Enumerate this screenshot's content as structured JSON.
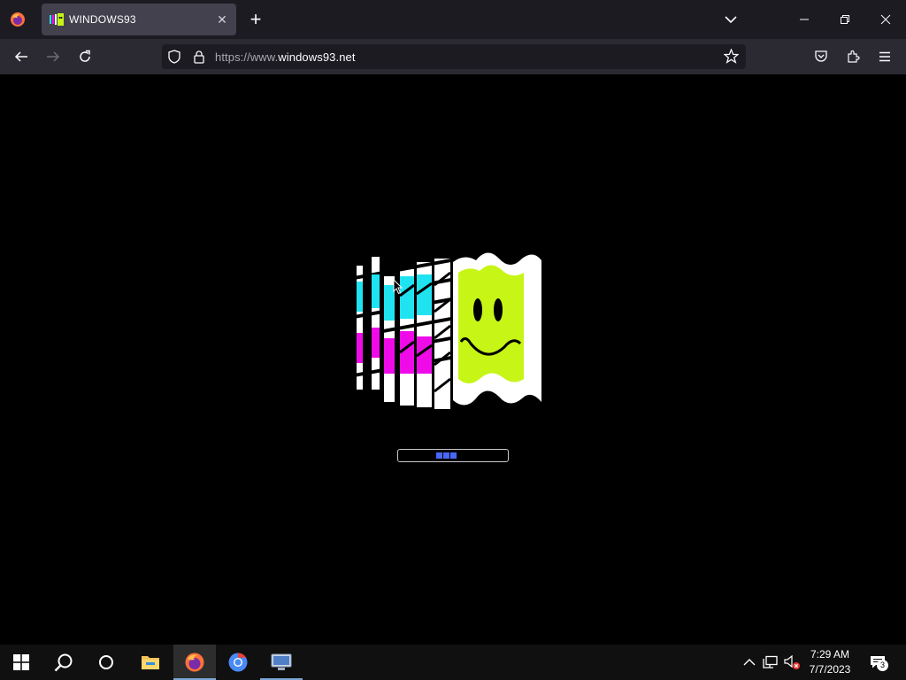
{
  "browser": {
    "tab": {
      "title": "WINDOWS93",
      "close_symbol": "✕"
    },
    "new_tab_symbol": "+",
    "address": {
      "prefix": "https://www.",
      "domain": "windows93.net"
    }
  },
  "page": {
    "loading_progress_blocks": 3,
    "colors": {
      "cyan": "#1fe3f0",
      "magenta": "#ee0be8",
      "lime": "#c6f516",
      "progress": "#4a68f5"
    }
  },
  "taskbar": {
    "clock": {
      "time": "7:29 AM",
      "date": "7/7/2023"
    },
    "notifications_count": "3",
    "pinned": [
      "start-button",
      "search-button",
      "cortana-button",
      "file-explorer",
      "firefox",
      "chrome",
      "remote-desktop"
    ]
  }
}
